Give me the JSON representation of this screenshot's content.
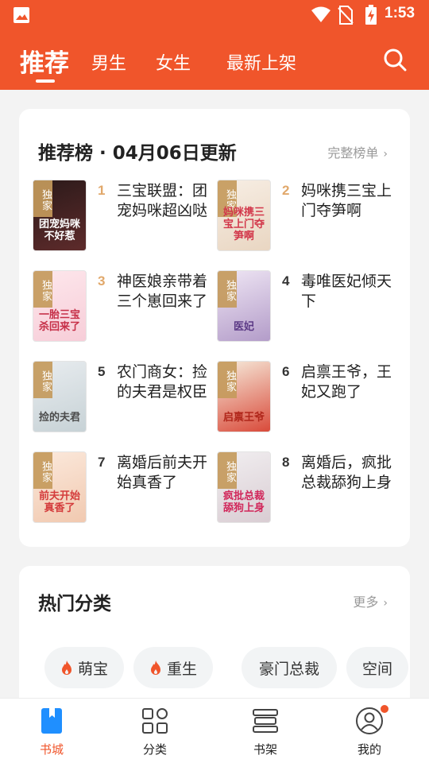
{
  "status_bar": {
    "time": "1:53"
  },
  "header": {
    "tabs": [
      {
        "label": "推荐",
        "active": true
      },
      {
        "label": "男生",
        "active": false
      },
      {
        "label": "女生",
        "active": false
      },
      {
        "label": "最新上架",
        "active": false
      }
    ],
    "accent_color": "#f0552b"
  },
  "ranking": {
    "title": "推荐榜 · 04月06日更新",
    "more_label": "完整榜单",
    "badge_label": "独家",
    "books": [
      {
        "rank": "1",
        "title": "三宝联盟：团宠妈咪超凶哒",
        "cover_text": "团宠妈咪不好惹",
        "cover_colors": [
          "#2b1a1a",
          "#5e2b2b"
        ],
        "cover_text_color": "#ffffff"
      },
      {
        "rank": "2",
        "title": "妈咪携三宝上门夺笋啊",
        "cover_text": "妈咪携三宝上门夺笋啊",
        "cover_colors": [
          "#f7eee4",
          "#e9d6c2"
        ],
        "cover_text_color": "#d2374a"
      },
      {
        "rank": "3",
        "title": "神医娘亲带着三个崽回来了",
        "cover_text": "一胎三宝杀回来了",
        "cover_colors": [
          "#fde7ec",
          "#f7cdd8"
        ],
        "cover_text_color": "#c62f48"
      },
      {
        "rank": "4",
        "title": "毒唯医妃倾天下",
        "cover_text": "医妃",
        "cover_colors": [
          "#efe6f4",
          "#b39cc9"
        ],
        "cover_text_color": "#5c3a86"
      },
      {
        "rank": "5",
        "title": "农门商女：捡的夫君是权臣",
        "cover_text": "捡的夫君",
        "cover_colors": [
          "#e8ecef",
          "#c7d2d6"
        ],
        "cover_text_color": "#4b4b4b"
      },
      {
        "rank": "6",
        "title": "启禀王爷，王妃又跑了",
        "cover_text": "启禀王爷",
        "cover_colors": [
          "#f6ecdc",
          "#d94a3a"
        ],
        "cover_text_color": "#b0261a"
      },
      {
        "rank": "7",
        "title": "离婚后前夫开始真香了",
        "cover_text": "前夫开始真香了",
        "cover_colors": [
          "#fbe9dc",
          "#f1c9b0"
        ],
        "cover_text_color": "#d43c3c"
      },
      {
        "rank": "8",
        "title": "离婚后，疯批总裁舔狗上身",
        "cover_text": "疯批总裁舔狗上身",
        "cover_colors": [
          "#f1eef0",
          "#d9cdd3"
        ],
        "cover_text_color": "#d1265a"
      }
    ]
  },
  "categories": {
    "title": "热门分类",
    "more_label": "更多",
    "chips": [
      {
        "label": "萌宝",
        "hot": true
      },
      {
        "label": "重生",
        "hot": true
      },
      {
        "label": "豪门总裁",
        "hot": false
      },
      {
        "label": "空间",
        "hot": false
      }
    ]
  },
  "bottom_nav": [
    {
      "label": "书城",
      "active": true,
      "icon": "book-store-icon"
    },
    {
      "label": "分类",
      "active": false,
      "icon": "category-grid-icon"
    },
    {
      "label": "书架",
      "active": false,
      "icon": "bookshelf-icon"
    },
    {
      "label": "我的",
      "active": false,
      "icon": "profile-icon",
      "notification": true
    }
  ]
}
